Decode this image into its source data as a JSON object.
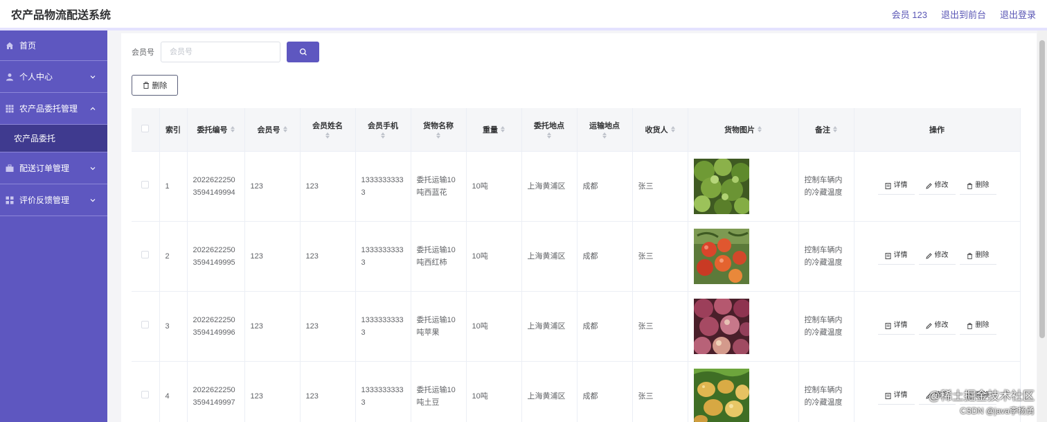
{
  "header": {
    "title": "农产品物流配送系统",
    "member_label": "会员 123",
    "back_label": "退出到前台",
    "logout_label": "退出登录"
  },
  "sidebar": {
    "items": [
      {
        "label": "首页",
        "icon": "home-icon"
      },
      {
        "label": "个人中心",
        "icon": "user-icon",
        "expanded": false
      },
      {
        "label": "农产品委托管理",
        "icon": "grid-icon",
        "expanded": true
      },
      {
        "label": "配送订单管理",
        "icon": "briefcase-icon",
        "expanded": false
      },
      {
        "label": "评价反馈管理",
        "icon": "apps-icon",
        "expanded": false
      }
    ],
    "submenu": {
      "label": "农产品委托",
      "active": true
    }
  },
  "search": {
    "label": "会员号",
    "placeholder": "会员号",
    "value": ""
  },
  "toolbar": {
    "delete_label": "删除"
  },
  "table": {
    "headers": {
      "index": "索引",
      "order_no": "委托编号",
      "member_no": "会员号",
      "member_name": "会员姓名",
      "member_phone": "会员手机",
      "goods_name": "货物名称",
      "weight": "重量",
      "origin": "委托地点",
      "destination": "运输地点",
      "receiver": "收货人",
      "image": "货物图片",
      "remark": "备注",
      "actions": "操作"
    },
    "action_labels": {
      "detail": "详情",
      "edit": "修改",
      "delete": "删除"
    },
    "rows": [
      {
        "index": "1",
        "order_no": "20226222503594149994",
        "member_no": "123",
        "member_name": "123",
        "member_phone": "13333333333",
        "goods_name": "委托运输10吨西蓝花",
        "weight": "10吨",
        "origin": "上海黄浦区",
        "destination": "成都",
        "receiver": "张三",
        "image": "broccoli",
        "remark": "控制车辆内的冷藏温度"
      },
      {
        "index": "2",
        "order_no": "20226222503594149995",
        "member_no": "123",
        "member_name": "123",
        "member_phone": "13333333333",
        "goods_name": "委托运输10吨西红柿",
        "weight": "10吨",
        "origin": "上海黄浦区",
        "destination": "成都",
        "receiver": "张三",
        "image": "tomato",
        "remark": "控制车辆内的冷藏温度"
      },
      {
        "index": "3",
        "order_no": "20226222503594149996",
        "member_no": "123",
        "member_name": "123",
        "member_phone": "13333333333",
        "goods_name": "委托运输10吨苹果",
        "weight": "10吨",
        "origin": "上海黄浦区",
        "destination": "成都",
        "receiver": "张三",
        "image": "apple",
        "remark": "控制车辆内的冷藏温度"
      },
      {
        "index": "4",
        "order_no": "20226222503594149997",
        "member_no": "123",
        "member_name": "123",
        "member_phone": "13333333333",
        "goods_name": "委托运输10吨土豆",
        "weight": "10吨",
        "origin": "上海黄浦区",
        "destination": "成都",
        "receiver": "张三",
        "image": "potato",
        "remark": "控制车辆内的冷藏温度"
      }
    ]
  },
  "watermark": {
    "line1": "@稀土掘金技术社区",
    "line2": "CSDN @java李杨勇"
  },
  "colors": {
    "brand": "#5e57c0",
    "submenu_active": "#3f3a8f",
    "header_bg": "#f5f6f8"
  }
}
